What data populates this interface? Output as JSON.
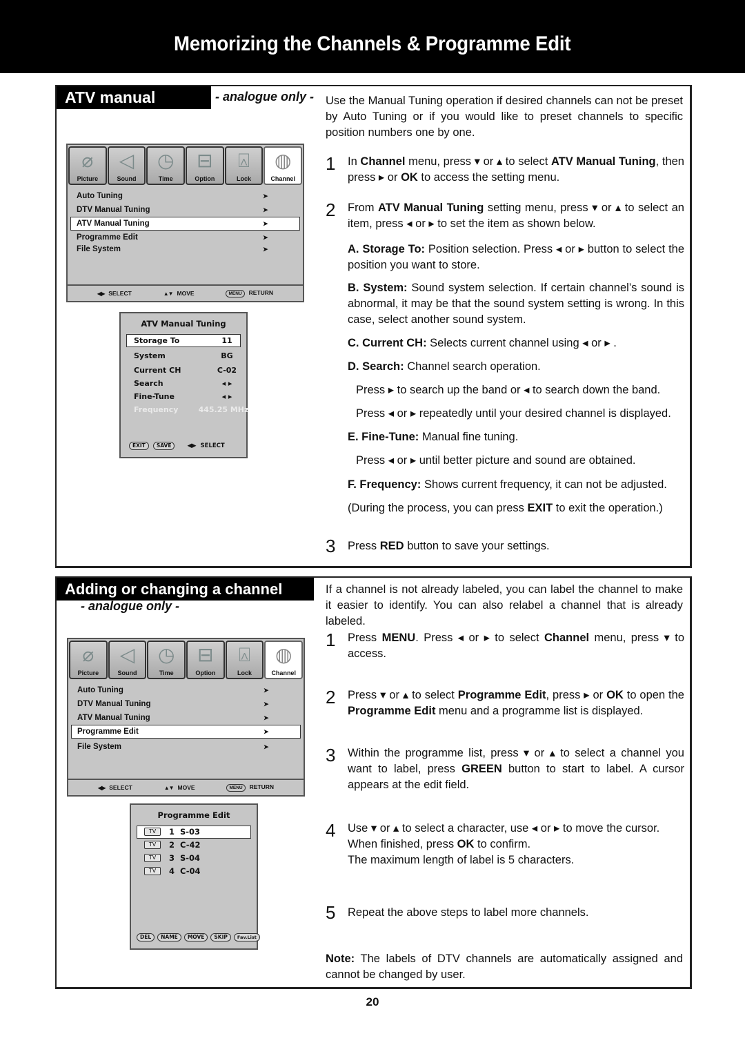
{
  "header": {
    "title": "Memorizing the Channels & Programme Edit"
  },
  "atv_section": {
    "title": "ATV manual tuning",
    "subtitle": "- analogue only -",
    "intro": "Use the Manual Tuning operation if desired channels can not be preset by Auto Tuning or if you would like to preset channels to specific position numbers one by one.",
    "menu": {
      "tabs": [
        {
          "label": "Picture",
          "icon": "satellite-dish-icon"
        },
        {
          "label": "Sound",
          "icon": "speaker-icon"
        },
        {
          "label": "Time",
          "icon": "clock-icon"
        },
        {
          "label": "Option",
          "icon": "toolbox-icon"
        },
        {
          "label": "Lock",
          "icon": "padlock-icon"
        },
        {
          "label": "Channel",
          "icon": "globe-icon",
          "active": true
        }
      ],
      "items": [
        "Auto Tuning",
        "DTV Manual Tuning",
        "ATV Manual Tuning",
        "Programme Edit",
        "File System"
      ],
      "selected_index": 2,
      "footer": {
        "select": "SELECT",
        "move": "MOVE",
        "menu_key": "MENU",
        "return": "RETURN"
      }
    },
    "submenu": {
      "title": "ATV Manual Tuning",
      "rows": [
        {
          "label": "Storage To",
          "value": "11"
        },
        {
          "label": "System",
          "value": "BG"
        },
        {
          "label": "Current CH",
          "value": "C-02"
        },
        {
          "label": "Search",
          "value": "◂ ▸"
        },
        {
          "label": "Fine-Tune",
          "value": "◂ ▸"
        },
        {
          "label": "Frequency",
          "value": "445.25 MHz"
        }
      ],
      "footer": {
        "exit": "EXIT",
        "save": "SAVE",
        "select": "SELECT"
      }
    },
    "steps": {
      "s1_num": "1",
      "s1": {
        "a": "In ",
        "b1": "Channel",
        "c": " menu,  press ▾ or ▴ to select ",
        "b2": "ATV Manual Tuning",
        "d": ", then press ▸ or ",
        "b3": "OK",
        "e": " to access the setting menu."
      },
      "s2_num": "2",
      "s2": {
        "a": "From ",
        "b1": "ATV Manual Tuning",
        "c": " setting menu, press ▾ or ▴ to select an item, press ◂ or ▸ to set the item as shown below."
      },
      "items": {
        "A_label": "A. Storage To:",
        "A_text": " Position selection. Press ◂ or ▸ button to select the position you want to store.",
        "B_label": "B. System:",
        "B_text": " Sound system selection. If certain channel’s sound is abnormal, it may be that the sound system setting is wrong. In this case, select another sound system.",
        "C_label": "C. Current CH:",
        "C_text": " Selects current channel using ◂ or ▸ .",
        "D_label": "D. Search:",
        "D_text": " Channel search operation.",
        "D_sub1": "Press ▸ to search up the band or ◂  to search down the band.",
        "D_sub2": "Press ◂ or ▸ repeatedly until your desired channel is displayed.",
        "E_label": "E. Fine-Tune:",
        "E_text": " Manual fine tuning.",
        "E_sub1": "Press ◂ or ▸ until better picture and sound are obtained.",
        "F_label": "F. Frequency:",
        "F_text": " Shows current frequency, it can not be adjusted.",
        "exit_a": "(During the process, you can press ",
        "exit_b": "EXIT",
        "exit_c": " to exit the operation.)"
      },
      "s3_num": "3",
      "s3": {
        "a": "Press ",
        "b": "RED",
        "c": " button to save your settings."
      }
    }
  },
  "label_section": {
    "title": "Adding or changing a channel label",
    "subtitle": "- analogue only -",
    "intro": "If a channel is not already labeled, you can label the channel to make it easier to identify. You can also relabel a channel that is already labeled.",
    "menu": {
      "tabs": [
        {
          "label": "Picture",
          "icon": "satellite-dish-icon"
        },
        {
          "label": "Sound",
          "icon": "speaker-icon"
        },
        {
          "label": "Time",
          "icon": "clock-icon"
        },
        {
          "label": "Option",
          "icon": "toolbox-icon"
        },
        {
          "label": "Lock",
          "icon": "padlock-icon"
        },
        {
          "label": "Channel",
          "icon": "globe-icon",
          "active": true
        }
      ],
      "items": [
        "Auto Tuning",
        "DTV Manual Tuning",
        "ATV Manual Tuning",
        "Programme Edit",
        "File System"
      ],
      "selected_index": 3,
      "footer": {
        "select": "SELECT",
        "move": "MOVE",
        "menu_key": "MENU",
        "return": "RETURN"
      }
    },
    "programme_edit": {
      "title": "Programme Edit",
      "rows": [
        {
          "type": "TV",
          "num": "1",
          "name": "S-03"
        },
        {
          "type": "TV",
          "num": "2",
          "name": "C-42"
        },
        {
          "type": "TV",
          "num": "3",
          "name": "S-04"
        },
        {
          "type": "TV",
          "num": "4",
          "name": "C-04"
        }
      ],
      "buttons": [
        "DEL",
        "NAME",
        "MOVE",
        "SKIP",
        "Fav.List"
      ]
    },
    "steps": {
      "s1_num": "1",
      "s1": {
        "a": "Press ",
        "b1": "MENU",
        "c": ". Press ◂ or ▸ to select ",
        "b2": "Channel",
        "d": " menu,  press ▾ to access."
      },
      "s2_num": "2",
      "s2": {
        "a": "Press ▾ or ▴  to select ",
        "b1": "Programme Edit",
        "c": ", press  ▸  or ",
        "b2": "OK",
        "d": " to open the ",
        "b3": "Programme Edit",
        "e": " menu and a programme list is displayed."
      },
      "s3_num": "3",
      "s3": {
        "a": "Within the programme list,  press ▾ or ▴ to select a channel you want to label, press ",
        "b": "GREEN",
        "c": " button to start to label. A cursor appears at the edit field."
      },
      "s4_num": "4",
      "s4": {
        "a": "Use ▾ or ▴  to select a character, use ◂ or ▸ to move the cursor. When finished, press ",
        "b": "OK",
        "c": " to confirm.",
        "d": "The maximum length of label is 5 characters."
      },
      "s5_num": "5",
      "s5": {
        "a": "Repeat the above steps to label more channels."
      }
    },
    "note": {
      "label": "Note:",
      "text": " The labels of DTV channels are automatically assigned and cannot be changed by user."
    }
  },
  "page_number": "20"
}
